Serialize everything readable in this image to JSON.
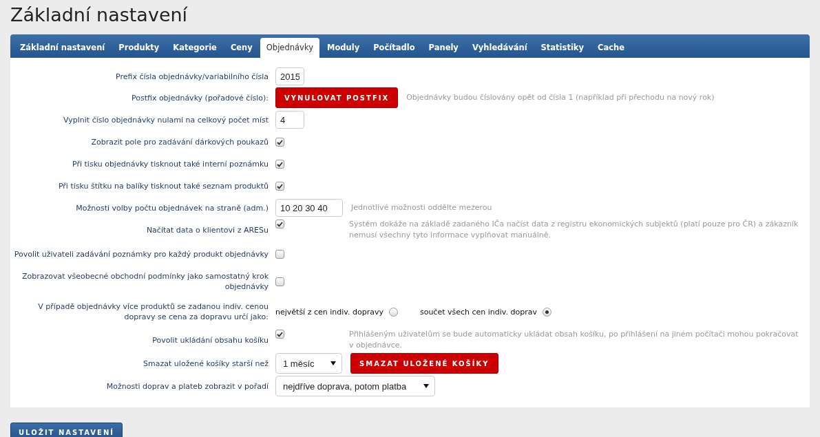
{
  "title": "Základní nastavení",
  "tabs": [
    {
      "label": "Základní nastavení",
      "selected": false
    },
    {
      "label": "Produkty",
      "selected": false
    },
    {
      "label": "Kategorie",
      "selected": false
    },
    {
      "label": "Ceny",
      "selected": false
    },
    {
      "label": "Objednávky",
      "selected": true
    },
    {
      "label": "Moduly",
      "selected": false
    },
    {
      "label": "Počítadlo",
      "selected": false
    },
    {
      "label": "Panely",
      "selected": false
    },
    {
      "label": "Vyhledávání",
      "selected": false
    },
    {
      "label": "Statistiky",
      "selected": false
    },
    {
      "label": "Cache",
      "selected": false
    }
  ],
  "rows": [
    {
      "kind": "text",
      "label": "Prefix čísla objednávky/variabilního čísla",
      "value": "2015"
    },
    {
      "kind": "button",
      "label": "Postfix objednávky (pořadové číslo):",
      "button": "VYNULOVAT POSTFIX",
      "hint": "Objednávky budou číslovány opět od čísla 1 (například při přechodu na nový rok)"
    },
    {
      "kind": "text",
      "label": "Vyplnit číslo objednávky nulami na celkový počet míst",
      "value": "4"
    },
    {
      "kind": "checkbox",
      "label": "Zobrazit pole pro zadávání dárkových poukazů",
      "checked": true
    },
    {
      "kind": "checkbox",
      "label": "Při tisku objednávky tisknout také interní poznámku",
      "checked": true
    },
    {
      "kind": "checkbox",
      "label": "Při tisku štítku na balíky tisknout také seznam produktů",
      "checked": true
    },
    {
      "kind": "text",
      "label": "Možnosti volby počtu objednávek na straně (adm.)",
      "value": "10 20 30 40",
      "hint": "Jednotlivé možnosti oddělte mezerou"
    },
    {
      "kind": "checkbox",
      "label": "Načítat data o klientovi z ARESu",
      "checked": true,
      "hint": "Systém dokáže na základě zadaného IČa načíst data z registru ekonomických subjektů (platí pouze pro ČR) a zákazník nemusí všechny tyto informace vyplňovat manuálně."
    },
    {
      "kind": "checkbox",
      "label": "Povolit uživateli zadávání poznámky pro každý produkt objednávky",
      "checked": false
    },
    {
      "kind": "checkbox",
      "label": "Zobrazovat všeobecné obchodní podmínky jako samostatný krok objednávky",
      "checked": false
    },
    {
      "kind": "radio",
      "label": "V případě objednávky více produktů se zadanou indiv. cenou dopravy se cena za dopravu určí jako:",
      "options": [
        {
          "label": "největší z cen indiv. dopravy",
          "selected": false
        },
        {
          "label": "součet všech cen indiv. doprav",
          "selected": true
        }
      ]
    },
    {
      "kind": "checkbox",
      "label": "Povolit ukládání obsahu košíku",
      "checked": true,
      "hint": "Přihlášeným uživatelům se bude automaticky ukládat obsah košíku, po přihlášení na jiném počítači mohou pokračovat v objednávce."
    },
    {
      "kind": "select",
      "label": "Smazat uložené košíky starší než",
      "value": "1 měsíc",
      "button": "SMAZAT ULOŽENÉ KOŠÍKY"
    },
    {
      "kind": "select",
      "label": "Možnosti doprav a plateb zobrazit v pořadí",
      "value": "nejdříve doprava, potom platba"
    }
  ],
  "save": "ULOŽIT NASTAVENÍ"
}
